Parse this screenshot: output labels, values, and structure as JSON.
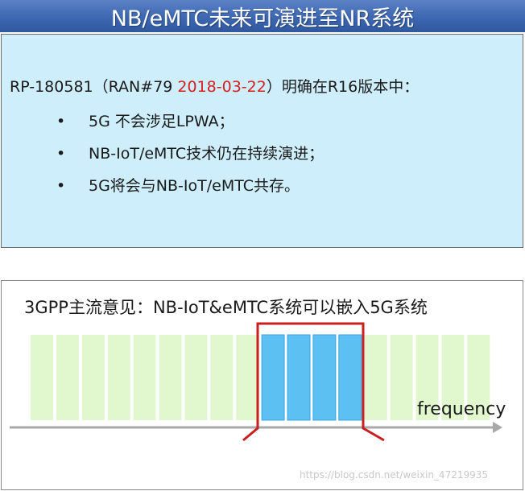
{
  "title": "NB/eMTC未来可演进至NR系统",
  "info": {
    "lead": "RP-180581（RAN#79 ",
    "date": "2018-03-22",
    "tail": "）明确在R16版本中：",
    "bullet_glyph": "•",
    "bullets": [
      "5G 不会涉足LPWA；",
      "NB-IoT/eMTC技术仍在持续演进；",
      "5G将会与NB-IoT/eMTC共存。"
    ]
  },
  "figure": {
    "caption": "3GPP主流意见：NB-IoT&eMTC系统可以嵌入5G系统",
    "axis_label": "frequency",
    "total_blocks": 18,
    "highlight_blocks": [
      9,
      10,
      11,
      12
    ],
    "colors": {
      "block": "#e1f8cf",
      "highlight": "#5cc0f3",
      "highlight_border": "#3aa6e2",
      "bracket": "#c9201e",
      "axis": "#a8a8a8"
    }
  },
  "watermark": "https://blog.csdn.net/weixin_47219935"
}
